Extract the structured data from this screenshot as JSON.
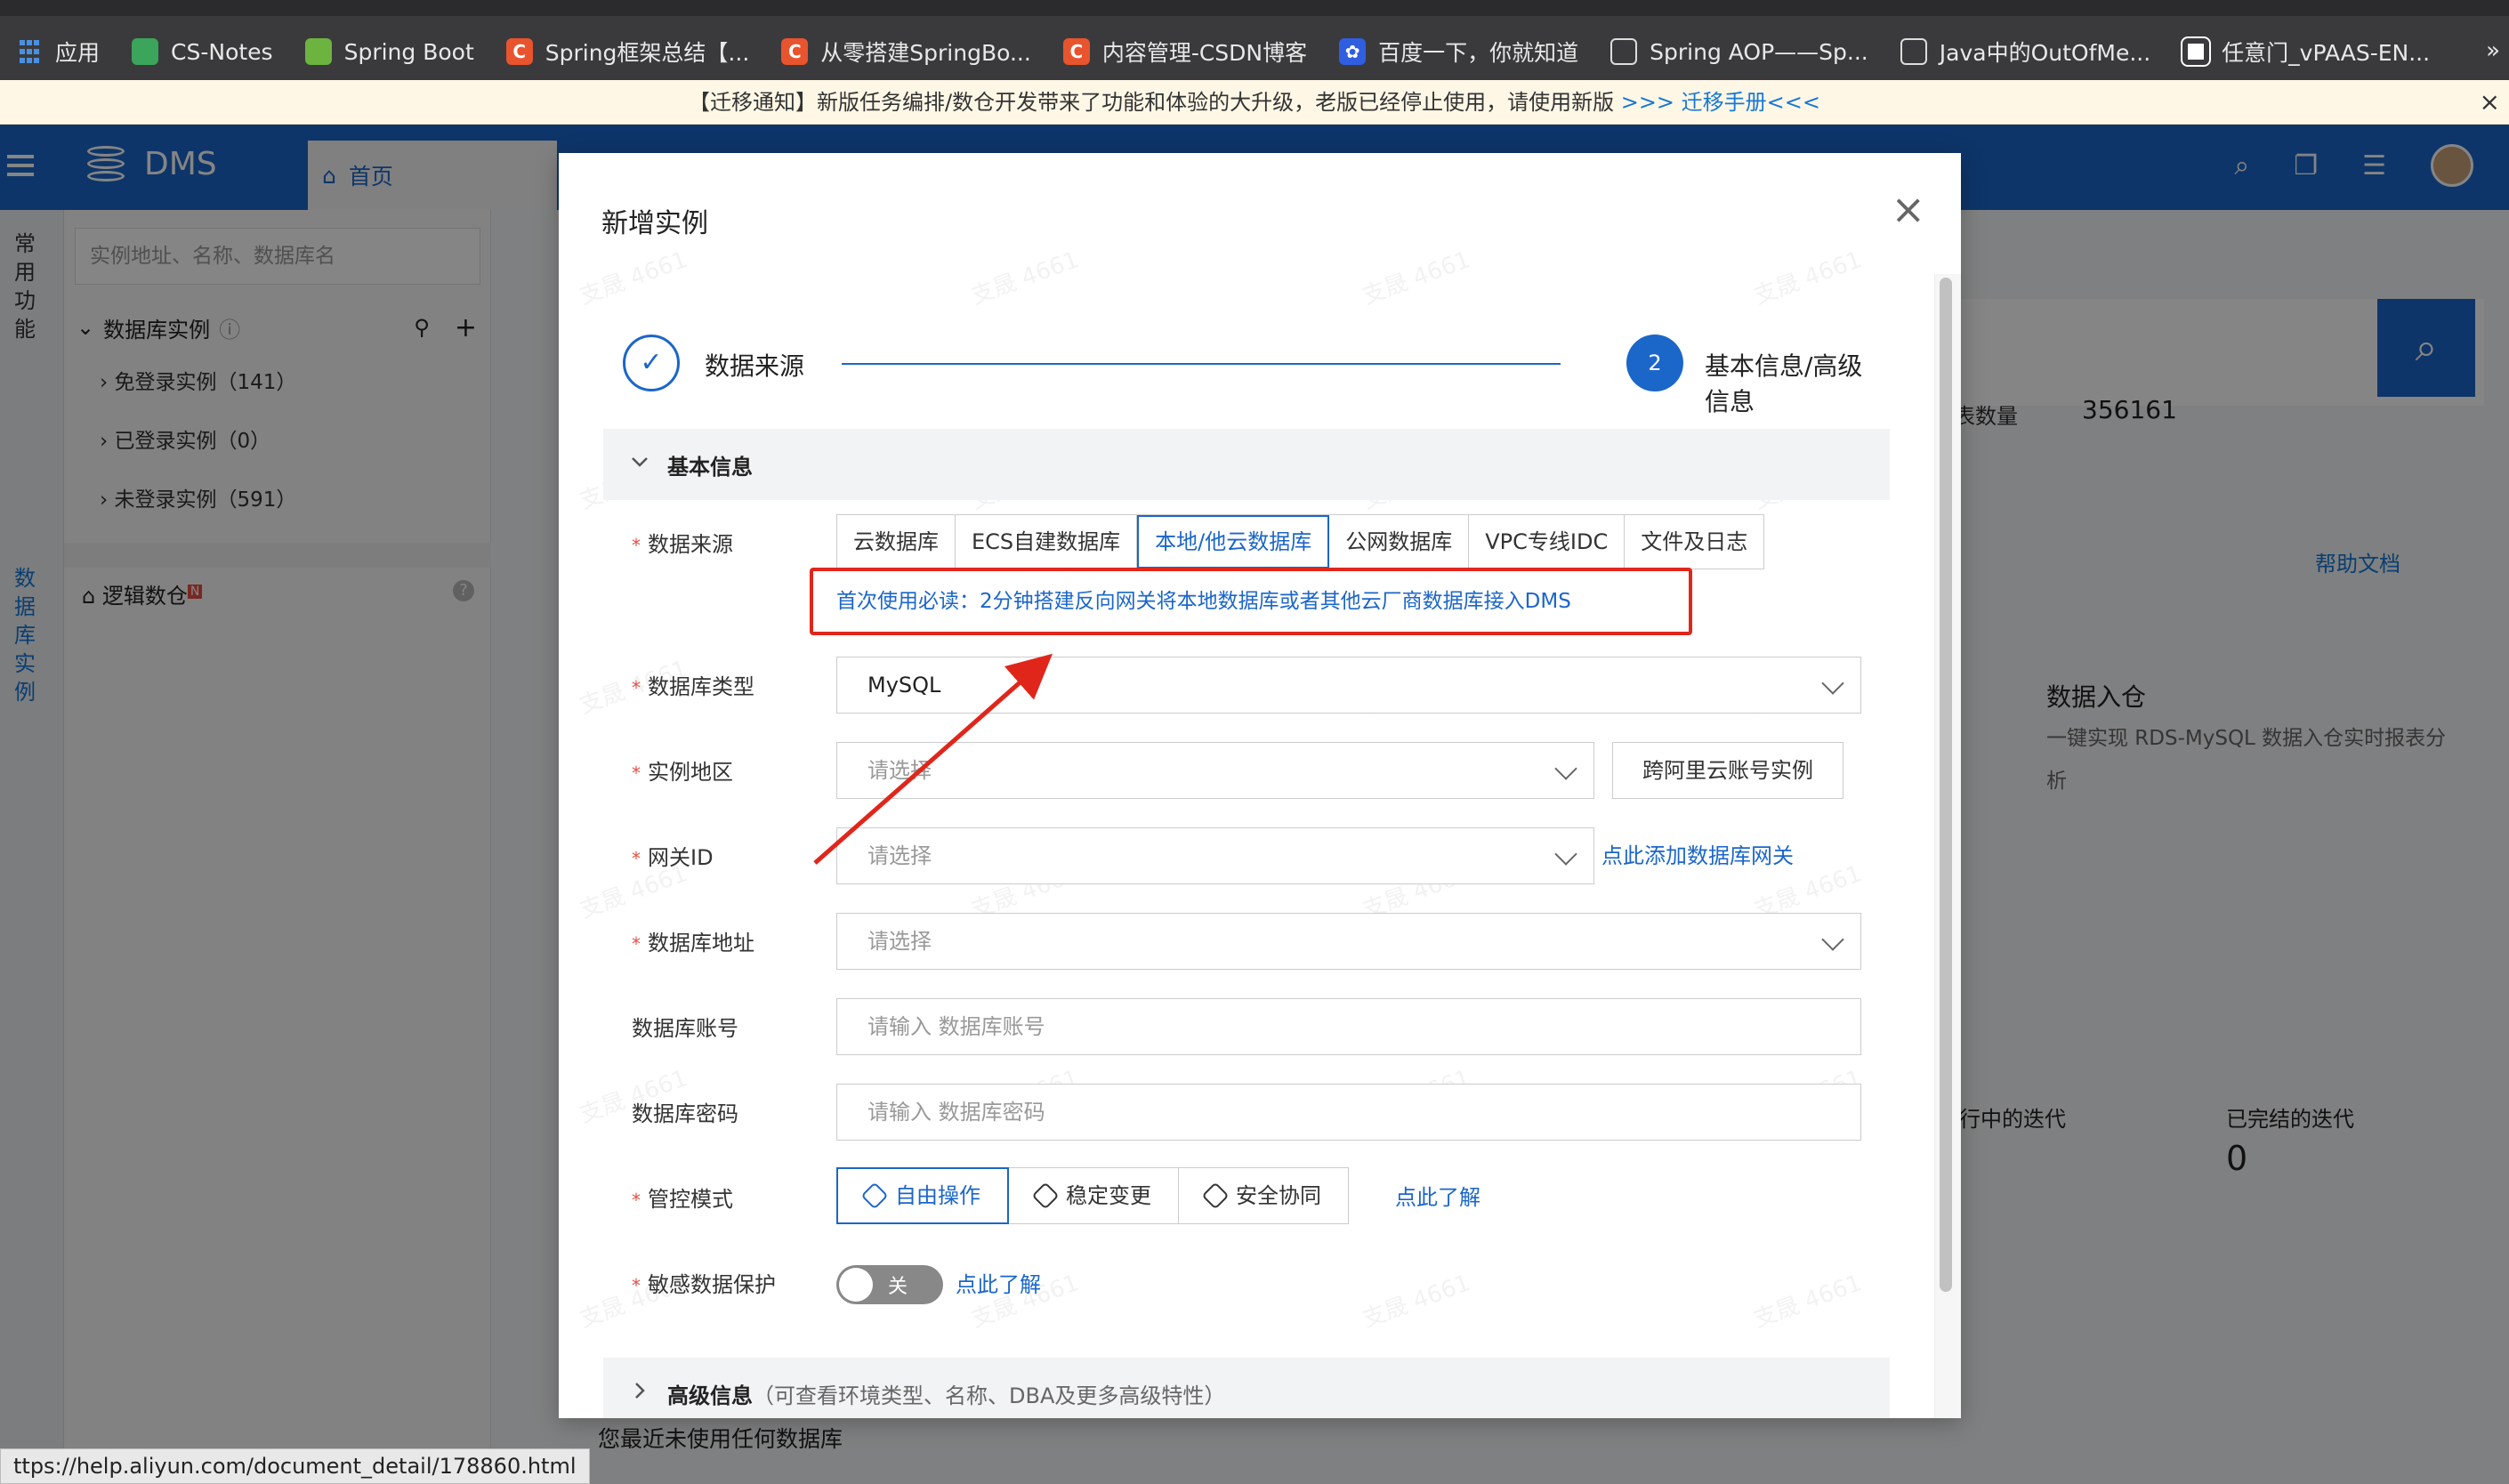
{
  "bookmarks": {
    "items": [
      {
        "label": "应用",
        "icon": "apps-grid-icon"
      },
      {
        "label": "CS-Notes",
        "icon": "green-dot-icon"
      },
      {
        "label": "Spring Boot",
        "icon": "spring-leaf-icon"
      },
      {
        "label": "Spring框架总结【...",
        "icon": "csdn-c-icon"
      },
      {
        "label": "从零搭建SpringBo...",
        "icon": "csdn-c-icon"
      },
      {
        "label": "内容管理-CSDN博客",
        "icon": "csdn-c-icon"
      },
      {
        "label": "百度一下，你就知道",
        "icon": "baidu-paw-icon"
      },
      {
        "label": "Spring AOP——Sp...",
        "icon": "feather-icon"
      },
      {
        "label": "Java中的OutOfMe...",
        "icon": "feather-icon"
      },
      {
        "label": "任意门_vPAAS-EN...",
        "icon": "dark-circle-icon"
      }
    ],
    "more": "»"
  },
  "notice": {
    "text": "【迁移通知】新版任务编排/数仓开发带来了功能和体验的大升级，老版已经停止使用，请使用新版 ",
    "link": ">>> 迁移手册<<<",
    "close": "×"
  },
  "topnav": {
    "logo": "DMS",
    "home_tab": "首页"
  },
  "leftrail": {
    "common": "常用功能",
    "db_instance": "数据库实例"
  },
  "panel": {
    "search_placeholder": "实例地址、名称、数据库名",
    "tree_title": "数据库实例",
    "items": [
      "免登录实例（141）",
      "已登录实例（0）",
      "未登录实例（591）"
    ],
    "logic": "逻辑数仓",
    "new_badge": "N"
  },
  "background": {
    "table_count_label": "表数量",
    "table_count": "356161",
    "help_doc": "帮助文档",
    "warehouse_title": "数据入仓",
    "warehouse_desc1": "一键实现 RDS-MySQL 数据入仓实时报表分",
    "warehouse_desc2": "析",
    "iter_running": "行中的迭代",
    "iter_done_label": "已完结的迭代",
    "iter_done_value": "0",
    "recent": "您最近未使用任何数据库"
  },
  "status_url": "ttps://help.aliyun.com/document_detail/178860.html",
  "modal": {
    "title": "新增实例",
    "close": "×",
    "steps": [
      {
        "label": "数据来源",
        "mark": "✓"
      },
      {
        "label": "基本信息/高级信息",
        "mark": "2"
      }
    ],
    "basic_section": "基本信息",
    "source_tabs": [
      "云数据库",
      "ECS自建数据库",
      "本地/他云数据库",
      "公网数据库",
      "VPC专线IDC",
      "文件及日志"
    ],
    "active_tab": "本地/他云数据库",
    "help_link": "首次使用必读：2分钟搭建反向网关将本地数据库或者其他云厂商数据库接入DMS",
    "fields": {
      "source_label": "数据来源",
      "db_type_label": "数据库类型",
      "db_type_value": "MySQL",
      "region_label": "实例地区",
      "region_placeholder": "请选择",
      "cross_account_button": "跨阿里云账号实例",
      "gateway_label": "网关ID",
      "gateway_placeholder": "请选择",
      "gateway_link": "点此添加数据库网关",
      "address_label": "数据库地址",
      "address_placeholder": "请选择",
      "account_label": "数据库账号",
      "account_placeholder": "请输入 数据库账号",
      "password_label": "数据库密码",
      "password_placeholder": "请输入 数据库密码",
      "control_label": "管控模式",
      "control_options": [
        "自由操作",
        "稳定变更",
        "安全协同"
      ],
      "control_link": "点此了解",
      "sensitive_label": "敏感数据保护",
      "sensitive_toggle": "关",
      "sensitive_link": "点此了解"
    },
    "advanced_section": "高级信息",
    "advanced_hint": "（可查看环境类型、名称、DBA及更多高级特性）"
  },
  "watermark": "支晟 4661",
  "colors": {
    "primary": "#1b66c9",
    "annotation_red": "#e0261b",
    "required": "#e54d42"
  }
}
